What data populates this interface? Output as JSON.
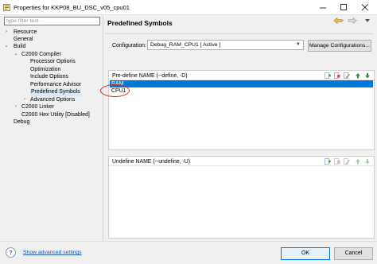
{
  "window": {
    "title": "Properties for KKP08_BU_DSC_v05_cpu01",
    "minimize_icon": "minimize-icon",
    "maximize_icon": "maximize-icon",
    "close_icon": "close-icon"
  },
  "sidebar": {
    "filter_placeholder": "type filter text",
    "items": [
      {
        "label": "Resource",
        "twisty": "›"
      },
      {
        "label": "General",
        "twisty": ""
      },
      {
        "label": "Build",
        "twisty": "⌄"
      },
      {
        "label": "C2000 Compiler",
        "twisty": "⌄"
      },
      {
        "label": "Processor Options",
        "twisty": ""
      },
      {
        "label": "Optimization",
        "twisty": ""
      },
      {
        "label": "Include Options",
        "twisty": ""
      },
      {
        "label": "Performance Advisor",
        "twisty": ""
      },
      {
        "label": "Predefined Symbols",
        "twisty": "",
        "selected": true
      },
      {
        "label": "Advanced Options",
        "twisty": "›"
      },
      {
        "label": "C2000 Linker",
        "twisty": "›"
      },
      {
        "label": "C2000 Hex Utility  [Disabled]",
        "twisty": ""
      },
      {
        "label": "Debug",
        "twisty": ""
      }
    ],
    "show_advanced": "Show advanced settings"
  },
  "page": {
    "title": "Predefined Symbols",
    "nav_icons": [
      "back-arrow-icon",
      "forward-arrow-icon",
      "menu-icon"
    ]
  },
  "configuration": {
    "label": "Configuration:",
    "value": "Debug_RAM_CPU1  [ Active ]",
    "manage_button": "Manage Configurations..."
  },
  "predefine": {
    "title": "Pre-define NAME (--define, -D)",
    "items": [
      "RAM",
      "CPU1"
    ],
    "selected_index": 0,
    "tools": [
      "add-icon",
      "delete-icon",
      "edit-icon",
      "move-up-icon",
      "move-down-icon"
    ]
  },
  "undefine": {
    "title": "Undefine NAME (--undefine, -U)",
    "items": [],
    "tools": [
      "add-icon",
      "delete-icon",
      "edit-icon",
      "move-up-icon",
      "move-down-icon"
    ]
  },
  "buttons": {
    "ok": "OK",
    "cancel": "Cancel"
  },
  "colors": {
    "selection": "#0078d7",
    "link": "#1a54b5",
    "annotation": "#e0201a"
  }
}
